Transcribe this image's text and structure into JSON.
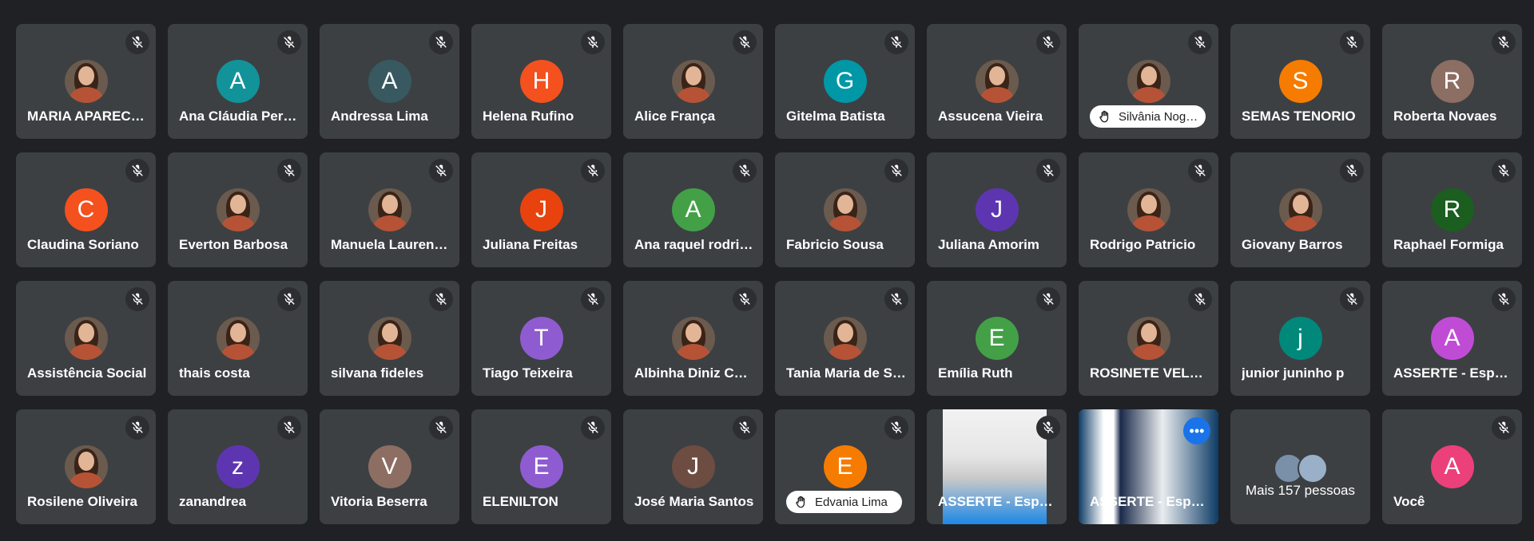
{
  "colors": {
    "background": "#202124",
    "tile": "#3c4043",
    "active_border": "#8ab4f8",
    "more_button": "#1a73e8"
  },
  "participants": [
    {
      "name": "MARIA APARECIDA",
      "avatar_type": "photo",
      "muted": true
    },
    {
      "name": "Ana Cláudia Pereira",
      "initial": "A",
      "color": "#12939a",
      "muted": true
    },
    {
      "name": "Andressa Lima",
      "initial": "A",
      "color": "#37595f",
      "muted": true
    },
    {
      "name": "Helena Rufino",
      "initial": "H",
      "color": "#f4511e",
      "muted": true
    },
    {
      "name": "Alice França",
      "avatar_type": "photo",
      "muted": true
    },
    {
      "name": "Gitelma Batista",
      "initial": "G",
      "color": "#0097a7",
      "muted": true
    },
    {
      "name": "Assucena Vieira",
      "avatar_type": "photo",
      "muted": true
    },
    {
      "name": "Silvânia Nogueira",
      "avatar_type": "photo",
      "muted": true,
      "hand_raised": true
    },
    {
      "name": "SEMAS TENORIO",
      "initial": "S",
      "color": "#f57c00",
      "muted": true
    },
    {
      "name": "Roberta Novaes",
      "initial": "R",
      "color": "#8d6e63",
      "muted": true
    },
    {
      "name": "Claudina Soriano",
      "initial": "C",
      "color": "#f4511e",
      "muted": true
    },
    {
      "name": "Everton Barbosa",
      "avatar_type": "photo",
      "muted": true
    },
    {
      "name": "Manuela Laurentino",
      "avatar_type": "photo",
      "muted": true
    },
    {
      "name": "Juliana Freitas",
      "initial": "J",
      "color": "#e8430e",
      "muted": true
    },
    {
      "name": "Ana raquel rodrigues",
      "initial": "A",
      "color": "#43a047",
      "muted": true
    },
    {
      "name": "Fabricio Sousa",
      "avatar_type": "photo",
      "muted": true
    },
    {
      "name": "Juliana Amorim",
      "initial": "J",
      "color": "#5e35b1",
      "muted": true
    },
    {
      "name": "Rodrigo Patricio",
      "avatar_type": "photo",
      "muted": true
    },
    {
      "name": "Giovany Barros",
      "avatar_type": "photo",
      "muted": true
    },
    {
      "name": "Raphael Formiga",
      "initial": "R",
      "color": "#1b5e20",
      "muted": true
    },
    {
      "name": "Assistência Social",
      "avatar_type": "photo",
      "muted": true
    },
    {
      "name": "thais costa",
      "avatar_type": "photo",
      "muted": true
    },
    {
      "name": "silvana fideles",
      "avatar_type": "photo",
      "muted": true
    },
    {
      "name": "Tiago Teixeira",
      "initial": "T",
      "color": "#8e5cd0",
      "muted": true
    },
    {
      "name": "Albinha Diniz Costa",
      "avatar_type": "photo",
      "muted": true
    },
    {
      "name": "Tania Maria de Souza",
      "avatar_type": "photo",
      "muted": true
    },
    {
      "name": "Emília Ruth",
      "initial": "E",
      "color": "#43a047",
      "muted": true
    },
    {
      "name": "ROSINETE VELOSO",
      "avatar_type": "photo",
      "muted": true
    },
    {
      "name": "junior juninho p",
      "initial": "j",
      "color": "#00897b",
      "muted": true
    },
    {
      "name": "ASSERTE - Espaço",
      "initial": "A",
      "color": "#c04cd6",
      "muted": true
    },
    {
      "name": "Rosilene Oliveira",
      "avatar_type": "photo",
      "muted": true
    },
    {
      "name": "zanandrea",
      "initial": "z",
      "color": "#5e35b1",
      "muted": true
    },
    {
      "name": "Vitoria Beserra",
      "initial": "V",
      "color": "#8d6e63",
      "muted": true
    },
    {
      "name": "ELENILTON",
      "initial": "E",
      "color": "#8e5cd0",
      "muted": true
    },
    {
      "name": "José Maria Santos",
      "initial": "J",
      "color": "#6d4c41",
      "muted": true
    },
    {
      "name": "Edvania Lima",
      "initial": "E",
      "color": "#f57c00",
      "muted": true,
      "hand_raised": true
    },
    {
      "name": "ASSERTE - Espaço",
      "avatar_type": "video",
      "muted": true
    },
    {
      "name": "ASSERTE - Espaço",
      "avatar_type": "video",
      "active": true,
      "muted": false,
      "more_button": true
    },
    {
      "type": "more",
      "label": "Mais 157 pessoas"
    },
    {
      "name": "Você",
      "initial": "A",
      "color": "#ec407a",
      "muted": true
    }
  ]
}
